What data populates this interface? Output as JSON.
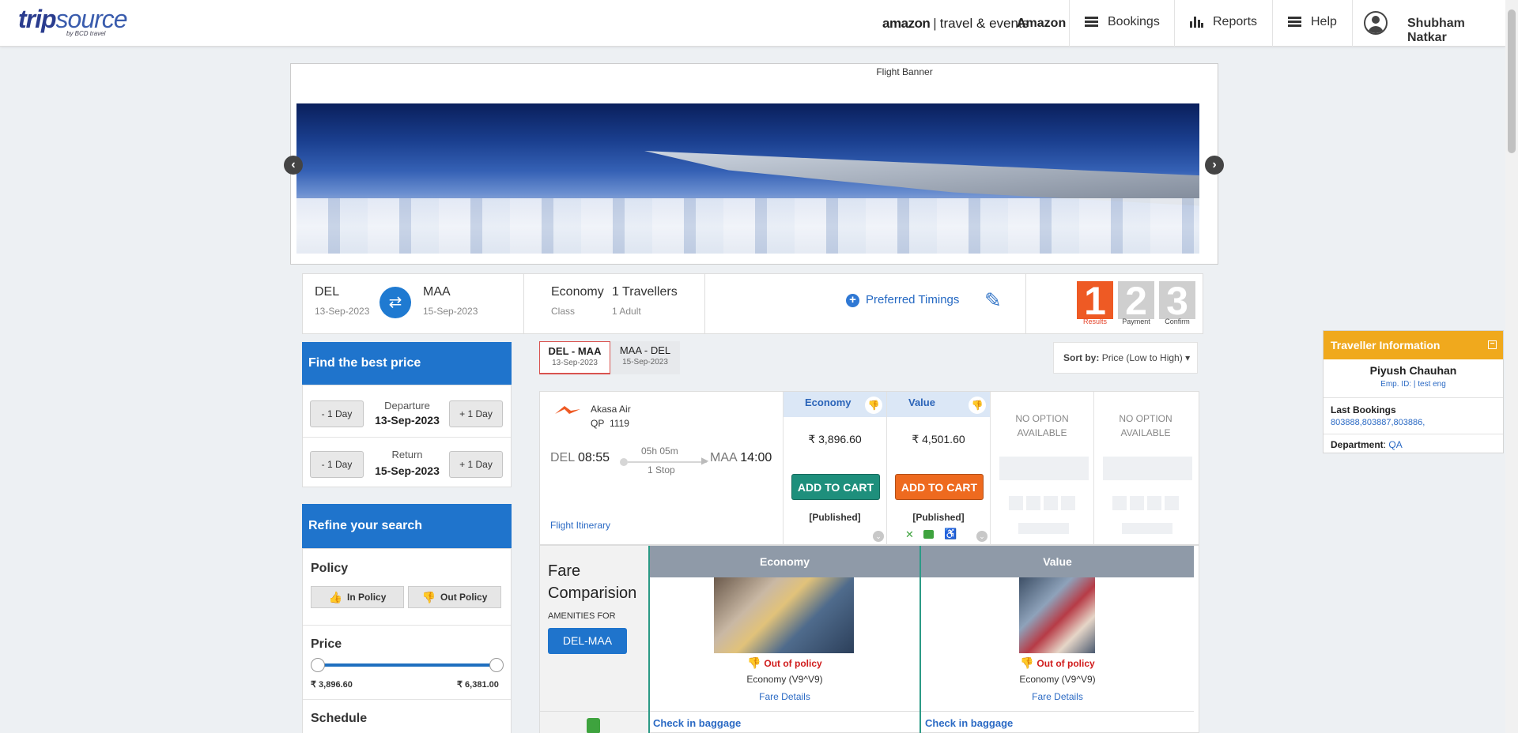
{
  "header": {
    "logo_text": "tripsource",
    "logo_sub": "by BCD travel",
    "amazon_brand": "amazon",
    "amazon_tagline": "travel & events",
    "company": "Amazon",
    "nav": [
      {
        "label": "Bookings",
        "icon": "hamburger-icon"
      },
      {
        "label": "Reports",
        "icon": "bar-chart-icon"
      },
      {
        "label": "Help",
        "icon": "hamburger-icon"
      }
    ],
    "user_name": "Shubham Natkar"
  },
  "banner": {
    "title": "Flight Banner"
  },
  "search_summary": {
    "origin": "DEL",
    "origin_date": "13-Sep-2023",
    "destination": "MAA",
    "destination_date": "15-Sep-2023",
    "class_value": "Economy",
    "class_label": "Class",
    "travellers_value": "1 Travellers",
    "travellers_label": "1 Adult",
    "preferred_timings": "Preferred Timings",
    "steps": [
      {
        "num": "1",
        "label": "Results",
        "active": true
      },
      {
        "num": "2",
        "label": "Payment",
        "active": false
      },
      {
        "num": "3",
        "label": "Confirm",
        "active": false
      }
    ]
  },
  "best_price": {
    "title": "Find the best price",
    "minus_day": "- 1 Day",
    "plus_day": "+ 1 Day",
    "departure_label": "Departure",
    "departure_date": "13-Sep-2023",
    "return_label": "Return",
    "return_date": "15-Sep-2023"
  },
  "refine": {
    "title": "Refine your search",
    "policy_title": "Policy",
    "in_policy": "In Policy",
    "out_policy": "Out Policy",
    "price_title": "Price",
    "price_min": "₹ 3,896.60",
    "price_max": "₹ 6,381.00",
    "schedule_title": "Schedule"
  },
  "route_tabs": [
    {
      "route": "DEL  -  MAA",
      "date": "13-Sep-2023",
      "active": true
    },
    {
      "route": "MAA  -  DEL",
      "date": "15-Sep-2023",
      "active": false
    }
  ],
  "sort": {
    "label": "Sort by:",
    "value": "Price (Low to High)"
  },
  "flight": {
    "airline": "Akasa Air",
    "flight_code": "QP",
    "flight_number": "1119",
    "from": "DEL",
    "dep_time": "08:55",
    "to": "MAA",
    "arr_time": "14:00",
    "duration": "05h 05m",
    "stops": "1 Stop",
    "itinerary_link": "Flight Itinerary",
    "fares": [
      {
        "name": "Economy",
        "price": "₹ 3,896.60",
        "button": "ADD TO CART",
        "tag": "[Published]",
        "color": "#1e8f7c"
      },
      {
        "name": "Value",
        "price": "₹ 4,501.60",
        "button": "ADD TO CART",
        "tag": "[Published]",
        "color": "#ee6a1f"
      }
    ],
    "no_option": "NO OPTION AVAILABLE"
  },
  "fare_comparison": {
    "title": "Fare Comparision",
    "amenities_label": "AMENITIES FOR",
    "route_btn": "DEL-MAA",
    "columns": [
      {
        "name": "Economy",
        "policy": "Out of policy",
        "fare_class": "Economy (V9^V9)",
        "details": "Fare Details",
        "baggage": "Check in baggage"
      },
      {
        "name": "Value",
        "policy": "Out of policy",
        "fare_class": "Economy (V9^V9)",
        "details": "Fare Details",
        "baggage": "Check in baggage"
      }
    ]
  },
  "traveller_info": {
    "title": "Traveller Information",
    "name": "Piyush Chauhan",
    "emp": "Emp. ID: | test eng",
    "last_bookings_label": "Last Bookings",
    "last_bookings": "803888,803887,803886,",
    "department_label": "Department",
    "department": "QA"
  },
  "colors": {
    "primary": "#1f74cc",
    "orange": "#f0a91d",
    "teal": "#1e8f7c",
    "cart_orange": "#ee6a1f",
    "step_active": "#ee5a24"
  }
}
